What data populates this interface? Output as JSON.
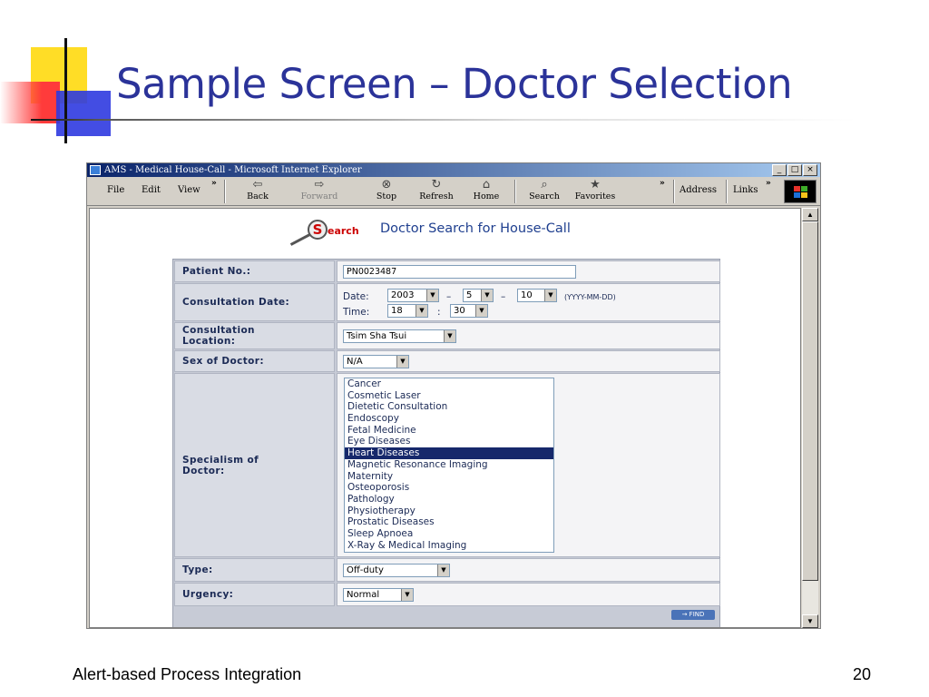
{
  "slide": {
    "title": "Sample Screen – Doctor Selection",
    "footer_left": "Alert-based Process Integration",
    "page_number": "20"
  },
  "browser": {
    "window_title": "AMS - Medical House-Call - Microsoft Internet Explorer",
    "window_buttons": {
      "minimize": "_",
      "maximize": "□",
      "close": "×"
    },
    "menu": [
      "File",
      "Edit",
      "View"
    ],
    "toolbar": {
      "back": "Back",
      "forward": "Forward",
      "stop": "Stop",
      "refresh": "Refresh",
      "home": "Home",
      "search": "Search",
      "favorites": "Favorites",
      "address": "Address",
      "links": "Links",
      "chevron": "»"
    },
    "icons": {
      "back": "⇦",
      "forward": "⇨",
      "stop": "⊗",
      "refresh": "↻",
      "home": "⌂",
      "search": "⌕",
      "favorites": "★",
      "dropdown": "▼",
      "scroll_up": "▲",
      "scroll_down": "▼"
    }
  },
  "page": {
    "search_logo_letter": "S",
    "search_logo_text": "earch",
    "heading": "Doctor Search for House-Call",
    "form": {
      "patient_no": {
        "label": "Patient No.:",
        "value": "PN0023487"
      },
      "consultation_date": {
        "label": "Consultation Date:",
        "date_label": "Date:",
        "year": "2003",
        "month": "5",
        "day": "10",
        "separator": "–",
        "format_hint": "(YYYY-MM-DD)",
        "time_label": "Time:",
        "hour": "18",
        "time_separator": ":",
        "minute": "30"
      },
      "consultation_location": {
        "label_line1": "Consultation",
        "label_line2": "Location:",
        "value": "Tsim Sha Tsui"
      },
      "sex_of_doctor": {
        "label": "Sex of Doctor:",
        "value": "N/A"
      },
      "specialism": {
        "label_line1": "Specialism of",
        "label_line2": "Doctor:",
        "options": [
          "Cancer",
          "Cosmetic Laser",
          "Dietetic Consultation",
          "Endoscopy",
          "Fetal Medicine",
          "Eye Diseases",
          "Heart Diseases",
          "Magnetic Resonance Imaging",
          "Maternity",
          "Osteoporosis",
          "Pathology",
          "Physiotherapy",
          "Prostatic Diseases",
          "Sleep Apnoea",
          "X-Ray & Medical Imaging"
        ],
        "selected": "Heart Diseases"
      },
      "type": {
        "label": "Type:",
        "value": "Off-duty"
      },
      "urgency": {
        "label": "Urgency:",
        "value": "Normal"
      }
    },
    "find_button": "→ FIND"
  }
}
